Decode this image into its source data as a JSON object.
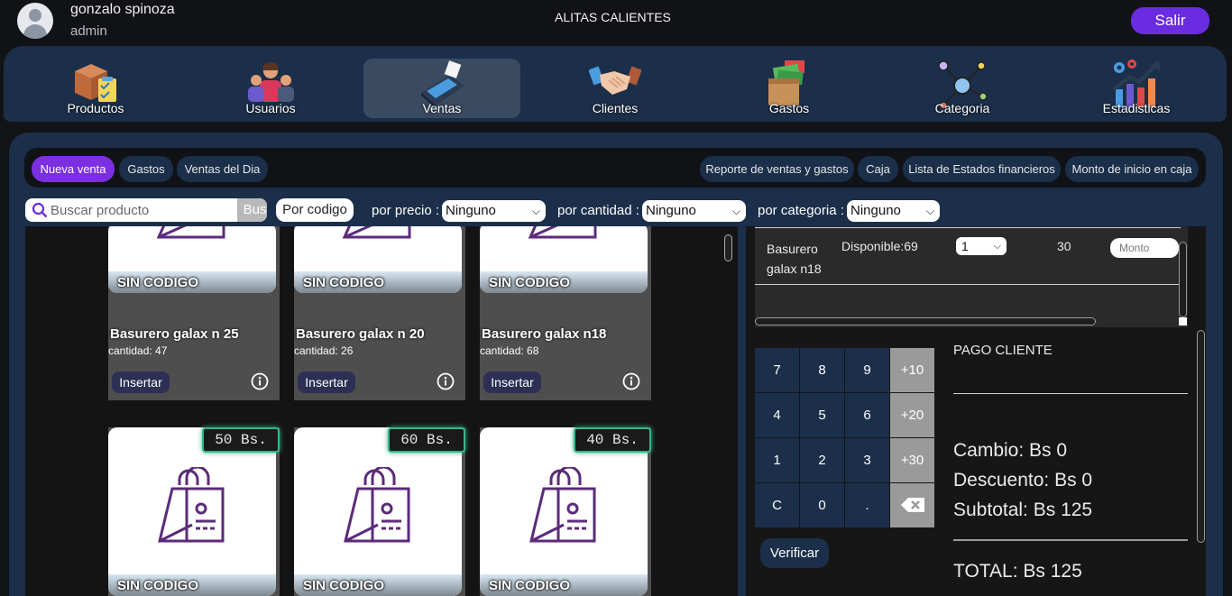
{
  "header": {
    "user_name": "gonzalo spinoza",
    "user_role": "admin",
    "app_title": "ALITAS CALIENTES",
    "logout_label": "Salir"
  },
  "nav": [
    {
      "label": "Productos",
      "icon": "box-clipboard-icon"
    },
    {
      "label": "Usuarios",
      "icon": "people-icon"
    },
    {
      "label": "Ventas",
      "icon": "card-terminal-icon",
      "active": true
    },
    {
      "label": "Clientes",
      "icon": "handshake-icon"
    },
    {
      "label": "Gastos",
      "icon": "money-box-icon"
    },
    {
      "label": "Categoria",
      "icon": "network-icon"
    },
    {
      "label": "Estadisticas",
      "icon": "chart-gears-icon"
    }
  ],
  "subnav": {
    "left": [
      "Nueva venta",
      "Gastos",
      "Ventas del Dia"
    ],
    "right": [
      "Reporte de ventas y gastos",
      "Caja",
      "Lista de Estados financieros",
      "Monto de inicio en caja"
    ]
  },
  "filters": {
    "search_placeholder": "Buscar producto",
    "search_button": "Buscar",
    "code_button": "Por codigo",
    "price_label": "por precio :",
    "price_value": "Ninguno",
    "qty_label": "por cantidad :",
    "qty_value": "Ninguno",
    "category_label": "por categoria :",
    "category_value": "Ninguno"
  },
  "products_row1": [
    {
      "code": "SIN CODIGO",
      "name": "Basurero galax n 25",
      "qty": "cantidad: 47",
      "insert": "Insertar"
    },
    {
      "code": "SIN CODIGO",
      "name": "Basurero galax n 20",
      "qty": "cantidad: 26",
      "insert": "Insertar"
    },
    {
      "code": "SIN CODIGO",
      "name": "Basurero galax n18",
      "qty": "cantidad: 68",
      "insert": "Insertar"
    }
  ],
  "products_row2": [
    {
      "price": "50 Bs.",
      "code": "SIN CODIGO"
    },
    {
      "price": "60 Bs.",
      "code": "SIN CODIGO"
    },
    {
      "price": "40 Bs.",
      "code": "SIN CODIGO"
    }
  ],
  "cart": {
    "name": "Basurero galax n18",
    "available": "Disponible:69",
    "qty": "1",
    "price": "30",
    "amount_placeholder": "Monto"
  },
  "keypad": [
    "7",
    "8",
    "9",
    "+10",
    "4",
    "5",
    "6",
    "+20",
    "1",
    "2",
    "3",
    "+30",
    "C",
    "0",
    "."
  ],
  "verify_label": "Verificar",
  "payment": {
    "title": "PAGO CLIENTE",
    "change": "Cambio: Bs 0",
    "discount": "Descuento: Bs 0",
    "subtotal": "Subtotal: Bs 125",
    "total": "TOTAL: Bs 125"
  },
  "colors": {
    "accent": "#6a2ce0",
    "panel": "#1b2f4a",
    "price_border": "#37b587"
  }
}
